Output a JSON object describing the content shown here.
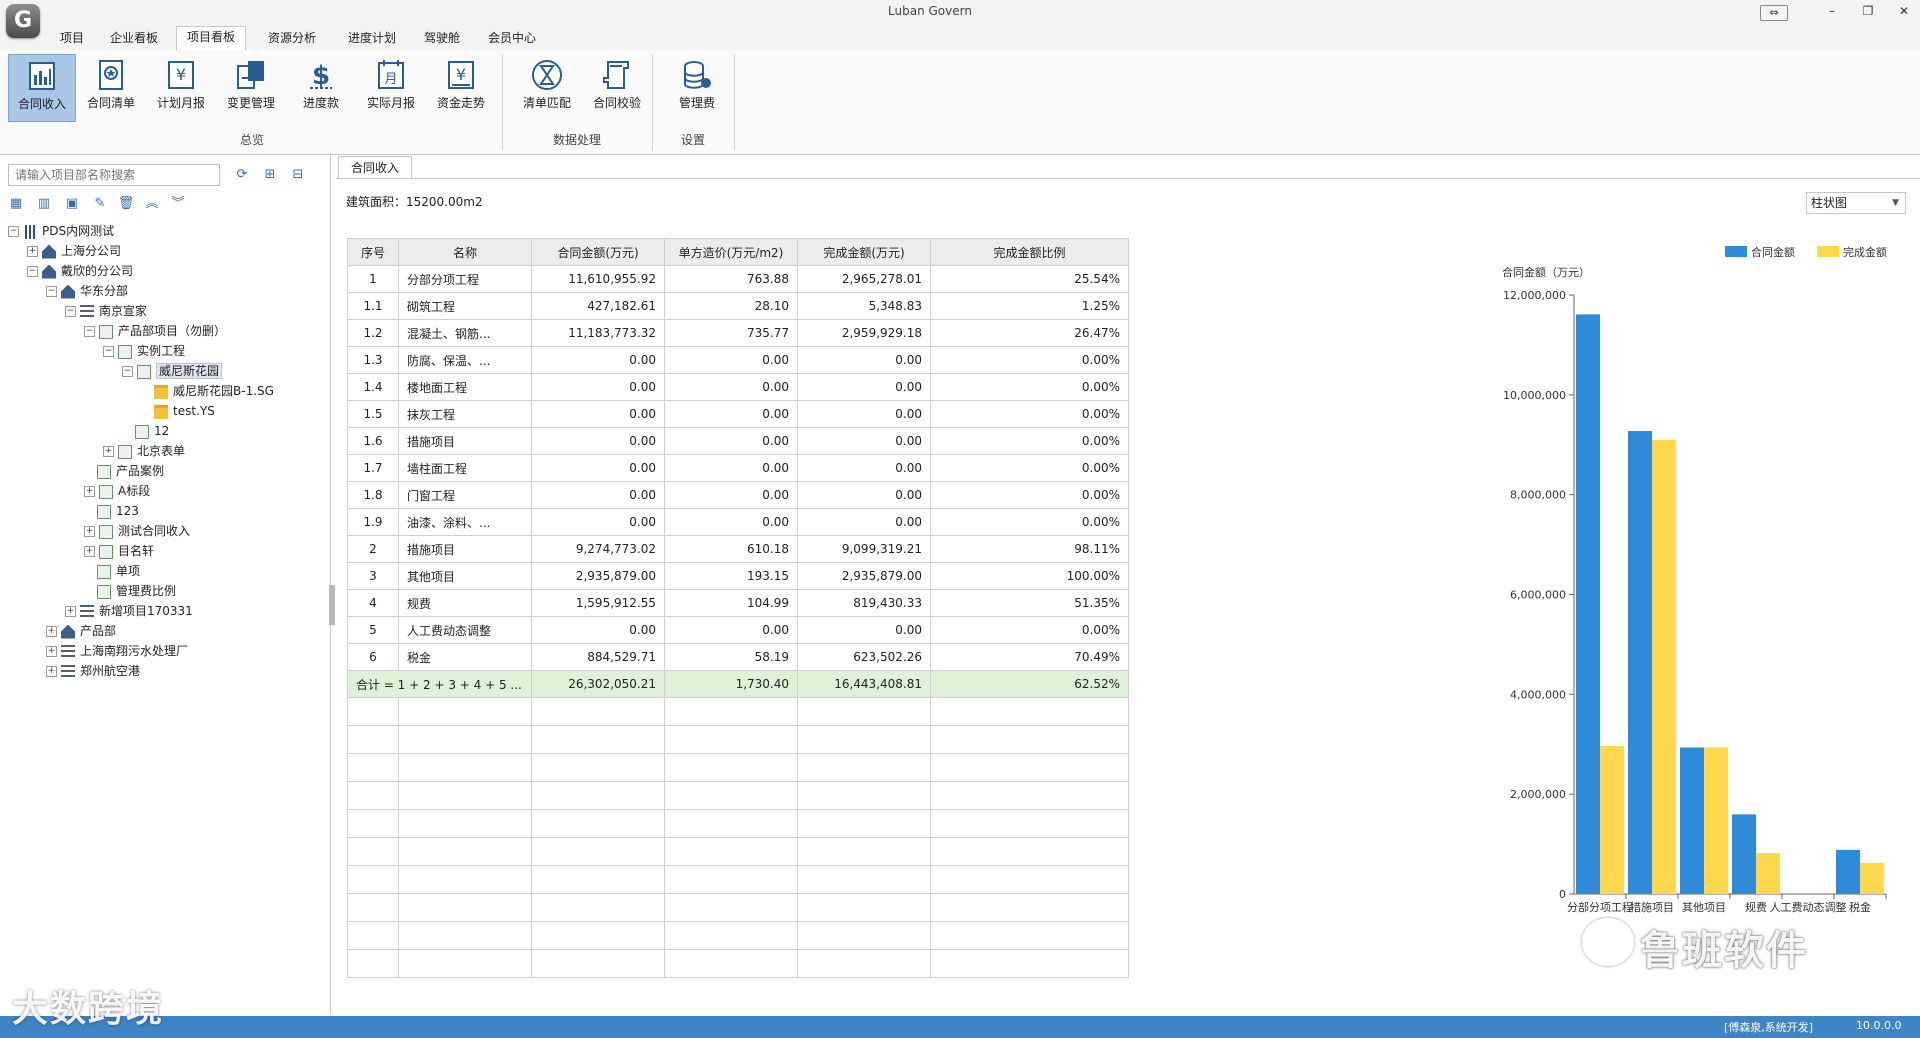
{
  "window": {
    "title": "Luban Govern",
    "logo": "G"
  },
  "menu": [
    "项目",
    "企业看板",
    "项目看板",
    "资源分析",
    "进度计划",
    "驾驶舱",
    "会员中心"
  ],
  "menu_active_index": 2,
  "ribbon": {
    "groups": [
      {
        "label": "总览",
        "buttons": [
          {
            "label": "合同收入",
            "icon": "bar-chart-icon",
            "active": true
          },
          {
            "label": "合同清单",
            "icon": "contract-list-icon"
          },
          {
            "label": "计划月报",
            "icon": "yen-report-icon"
          },
          {
            "label": "变更管理",
            "icon": "change-manage-icon"
          },
          {
            "label": "进度款",
            "icon": "dollar-icon"
          },
          {
            "label": "实际月报",
            "icon": "calendar-report-icon"
          },
          {
            "label": "资金走势",
            "icon": "yen-trend-icon"
          }
        ]
      },
      {
        "label": "数据处理",
        "buttons": [
          {
            "label": "清单匹配",
            "icon": "hourglass-match-icon"
          },
          {
            "label": "合同校验",
            "icon": "scroll-check-icon"
          }
        ]
      },
      {
        "label": "设置",
        "buttons": [
          {
            "label": "管理费",
            "icon": "database-icon"
          }
        ]
      }
    ]
  },
  "left_panel": {
    "search_placeholder": "请输入项目部名称搜索",
    "tree": [
      {
        "label": "PDS内网测试",
        "depth": 0,
        "expander": "−",
        "icon": "bar"
      },
      {
        "label": "上海分公司",
        "depth": 1,
        "expander": "+",
        "icon": "org"
      },
      {
        "label": "戴欣的分公司",
        "depth": 1,
        "expander": "−",
        "icon": "org"
      },
      {
        "label": "华东分部",
        "depth": 2,
        "expander": "−",
        "icon": "org"
      },
      {
        "label": "南京宣家",
        "depth": 3,
        "expander": "−",
        "icon": "list"
      },
      {
        "label": "产品部项目（勿删）",
        "depth": 4,
        "expander": "−",
        "icon": "proj"
      },
      {
        "label": "实例工程",
        "depth": 5,
        "expander": "−",
        "icon": "proj"
      },
      {
        "label": "威尼斯花园",
        "depth": 6,
        "expander": "−",
        "icon": "proj",
        "selected": true
      },
      {
        "label": "威尼斯花园B-1.SG",
        "depth": 7,
        "expander": "",
        "icon": "folder"
      },
      {
        "label": "test.YS",
        "depth": 7,
        "expander": "",
        "icon": "folder"
      },
      {
        "label": "12",
        "depth": 6,
        "expander": "",
        "icon": "proj"
      },
      {
        "label": "北京表单",
        "depth": 5,
        "expander": "+",
        "icon": "proj"
      },
      {
        "label": "产品案例",
        "depth": 4,
        "expander": "",
        "icon": "proj"
      },
      {
        "label": "A标段",
        "depth": 4,
        "expander": "+",
        "icon": "proj"
      },
      {
        "label": "123",
        "depth": 4,
        "expander": "",
        "icon": "proj"
      },
      {
        "label": "测试合同收入",
        "depth": 4,
        "expander": "+",
        "icon": "proj"
      },
      {
        "label": "目名轩",
        "depth": 4,
        "expander": "+",
        "icon": "proj"
      },
      {
        "label": "单项",
        "depth": 4,
        "expander": "",
        "icon": "proj"
      },
      {
        "label": "管理费比例",
        "depth": 4,
        "expander": "",
        "icon": "proj"
      },
      {
        "label": "新增项目170331",
        "depth": 3,
        "expander": "+",
        "icon": "list"
      },
      {
        "label": "产品部",
        "depth": 2,
        "expander": "+",
        "icon": "org"
      },
      {
        "label": "上海南翔污水处理厂",
        "depth": 2,
        "expander": "+",
        "icon": "list"
      },
      {
        "label": "郑州航空港",
        "depth": 2,
        "expander": "+",
        "icon": "list"
      }
    ]
  },
  "content": {
    "tab": "合同收入",
    "area_label": "建筑面积：15200.00m2",
    "chart_type_select": "柱状图"
  },
  "table": {
    "headers": [
      "序号",
      "名称",
      "合同金额(万元)",
      "单方造价(万元/m2)",
      "完成金额(万元)",
      "完成金额比例"
    ],
    "rows": [
      [
        "1",
        "分部分项工程",
        "11,610,955.92",
        "763.88",
        "2,965,278.01",
        "25.54%"
      ],
      [
        "1.1",
        "砌筑工程",
        "427,182.61",
        "28.10",
        "5,348.83",
        "1.25%"
      ],
      [
        "1.2",
        "混凝土、钢筋...",
        "11,183,773.32",
        "735.77",
        "2,959,929.18",
        "26.47%"
      ],
      [
        "1.3",
        "防腐、保温、...",
        "0.00",
        "0.00",
        "0.00",
        "0.00%"
      ],
      [
        "1.4",
        "楼地面工程",
        "0.00",
        "0.00",
        "0.00",
        "0.00%"
      ],
      [
        "1.5",
        "抹灰工程",
        "0.00",
        "0.00",
        "0.00",
        "0.00%"
      ],
      [
        "1.6",
        "措施项目",
        "0.00",
        "0.00",
        "0.00",
        "0.00%"
      ],
      [
        "1.7",
        "墙柱面工程",
        "0.00",
        "0.00",
        "0.00",
        "0.00%"
      ],
      [
        "1.8",
        "门窗工程",
        "0.00",
        "0.00",
        "0.00",
        "0.00%"
      ],
      [
        "1.9",
        "油漆、涂料、...",
        "0.00",
        "0.00",
        "0.00",
        "0.00%"
      ],
      [
        "2",
        "措施项目",
        "9,274,773.02",
        "610.18",
        "9,099,319.21",
        "98.11%"
      ],
      [
        "3",
        "其他项目",
        "2,935,879.00",
        "193.15",
        "2,935,879.00",
        "100.00%"
      ],
      [
        "4",
        "规费",
        "1,595,912.55",
        "104.99",
        "819,430.33",
        "51.35%"
      ],
      [
        "5",
        "人工费动态调整",
        "0.00",
        "0.00",
        "0.00",
        "0.00%"
      ],
      [
        "6",
        "税金",
        "884,529.71",
        "58.19",
        "623,502.26",
        "70.49%"
      ]
    ],
    "total": [
      "合计 = 1 + 2 + 3 + 4 + 5 ...",
      "26,302,050.21",
      "1,730.40",
      "16,443,408.81",
      "62.52%"
    ],
    "empty_rows": 10
  },
  "chart_data": {
    "type": "bar",
    "title": "",
    "ylabel": "合同金额（万元）",
    "xlabel": "",
    "categories": [
      "分部分项工程",
      "措施项目",
      "其他项目",
      "规费",
      "人工费动态调整",
      "税金"
    ],
    "series": [
      {
        "name": "合同金额",
        "color": "#2f8ad8",
        "values": [
          11610955.92,
          9274773.02,
          2935879.0,
          1595912.55,
          0,
          884529.71
        ]
      },
      {
        "name": "完成金额",
        "color": "#ffd84f",
        "values": [
          2965278.01,
          9099319.21,
          2935879.0,
          819430.33,
          0,
          623502.26
        ]
      }
    ],
    "ylim": [
      0,
      12000000
    ],
    "yticks": [
      "0",
      "2,000,000",
      "4,000,000",
      "6,000,000",
      "8,000,000",
      "10,000,000",
      "12,000,000"
    ],
    "legend": "top-center",
    "grid": false
  },
  "status": {
    "user": "[傅森泉,系统开发]",
    "version": "10.0.0.0"
  },
  "watermarks": {
    "left": "大数跨境",
    "right": "鲁班软件"
  }
}
